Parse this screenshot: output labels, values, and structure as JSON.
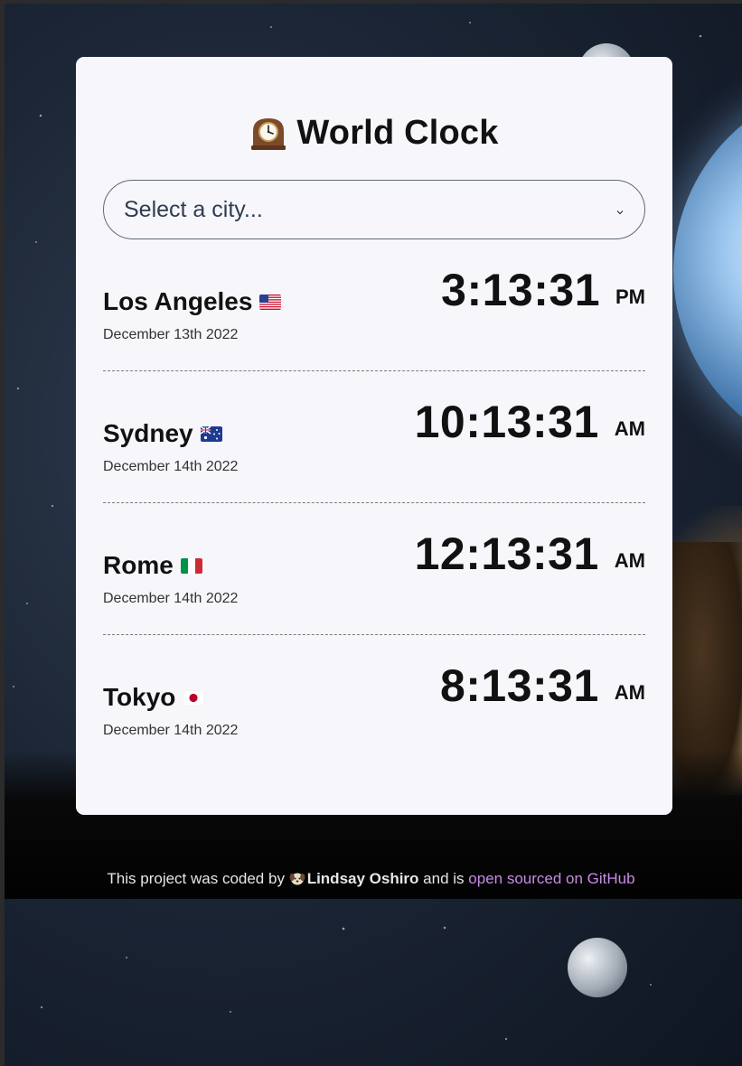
{
  "app": {
    "title": "World Clock",
    "title_icon": "mantelpiece-clock-icon"
  },
  "city_select": {
    "placeholder": "Select a city...",
    "icon": "chevron-down-icon"
  },
  "cities": [
    {
      "name": "Los Angeles",
      "flag": "us-flag-icon",
      "date": "December 13th 2022",
      "time": "3:13:31",
      "ampm": "PM"
    },
    {
      "name": "Sydney",
      "flag": "australia-flag-icon",
      "date": "December 14th 2022",
      "time": "10:13:31",
      "ampm": "AM"
    },
    {
      "name": "Rome",
      "flag": "italy-flag-icon",
      "date": "December 14th 2022",
      "time": "12:13:31",
      "ampm": "AM"
    },
    {
      "name": "Tokyo",
      "flag": "japan-flag-icon",
      "date": "December 14th 2022",
      "time": "8:13:31",
      "ampm": "AM"
    }
  ],
  "footer": {
    "prefix": "This project was coded by",
    "author_icon": "puppy-icon",
    "author": "Lindsay Oshiro",
    "middle": "and is",
    "link_text": "open sourced on GitHub"
  },
  "colors": {
    "card_background": "#f7f6fb",
    "link": "#c78ce6",
    "text": "#111111"
  }
}
